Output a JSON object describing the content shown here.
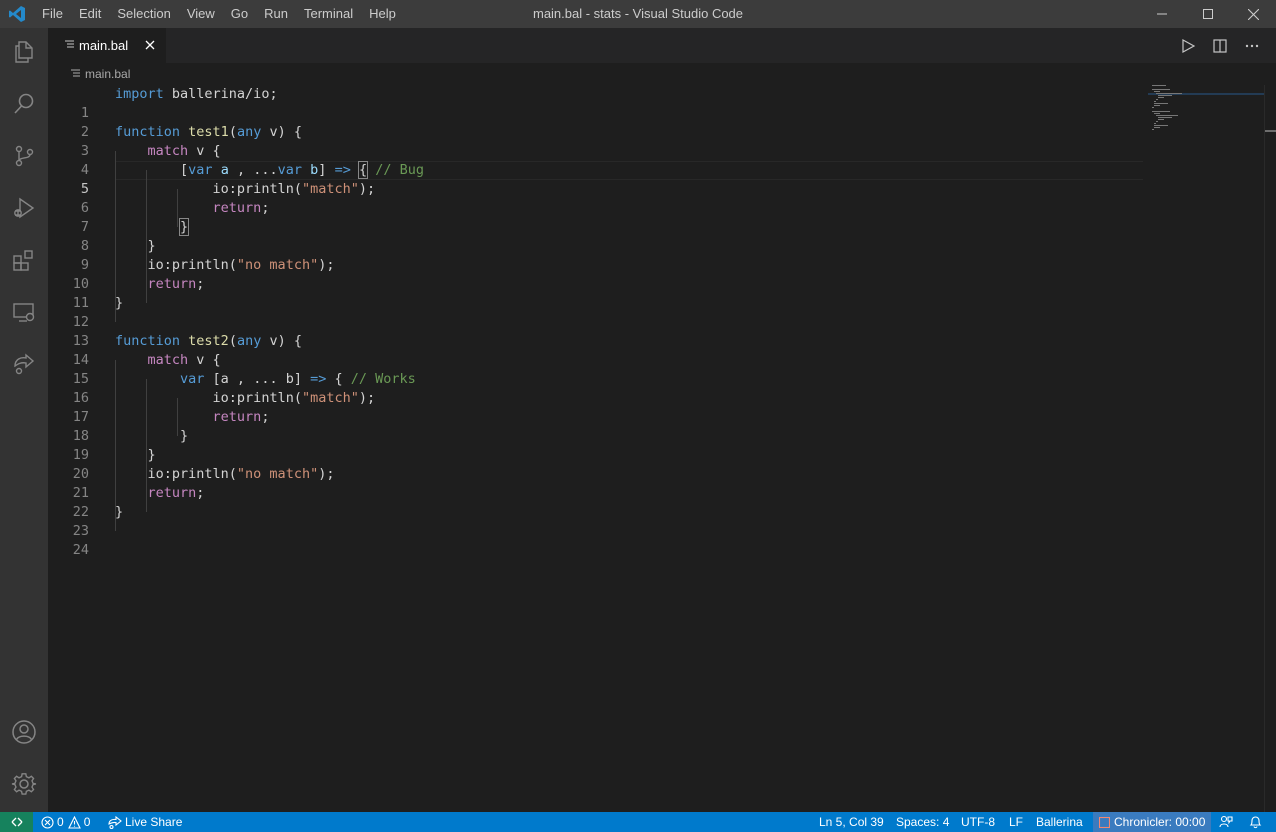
{
  "window": {
    "menu": [
      "File",
      "Edit",
      "Selection",
      "View",
      "Go",
      "Run",
      "Terminal",
      "Help"
    ],
    "title": "main.bal - stats - Visual Studio Code"
  },
  "activity_bar": {
    "items": [
      "explorer-icon",
      "search-icon",
      "source-control-icon",
      "run-debug-icon",
      "extensions-icon",
      "remote-explorer-icon",
      "live-share-icon"
    ],
    "bottom": [
      "account-icon",
      "settings-gear-icon"
    ]
  },
  "tab": {
    "label": "main.bal",
    "icon": "file-lines-icon"
  },
  "breadcrumb": {
    "label": "main.bal"
  },
  "editor": {
    "active_line": 5,
    "lines": [
      {
        "n": "1"
      },
      {
        "n": "2"
      },
      {
        "n": "3"
      },
      {
        "n": "4"
      },
      {
        "n": "5"
      },
      {
        "n": "6"
      },
      {
        "n": "7"
      },
      {
        "n": "8"
      },
      {
        "n": "9"
      },
      {
        "n": "10"
      },
      {
        "n": "11"
      },
      {
        "n": "12"
      },
      {
        "n": "13"
      },
      {
        "n": "14"
      },
      {
        "n": "15"
      },
      {
        "n": "16"
      },
      {
        "n": "17"
      },
      {
        "n": "18"
      },
      {
        "n": "19"
      },
      {
        "n": "20"
      },
      {
        "n": "21"
      },
      {
        "n": "22"
      },
      {
        "n": "23"
      },
      {
        "n": "24"
      }
    ],
    "tokens": {
      "l1": [
        "import",
        " ballerina/io;"
      ],
      "l3": [
        "function",
        " ",
        "test1",
        "(",
        "any",
        " v) {"
      ],
      "l4": [
        "match",
        " v {"
      ],
      "l5": [
        "[",
        "var",
        " ",
        "a",
        " , ...",
        "var",
        " ",
        "b",
        "] ",
        "=>",
        " ",
        "{",
        " ",
        "// Bug"
      ],
      "l6": [
        "io:println(",
        "\"match\"",
        ");"
      ],
      "l7": [
        "return",
        ";"
      ],
      "l8": [
        "}"
      ],
      "l9": [
        "}"
      ],
      "l10": [
        "io:println(",
        "\"no match\"",
        ");"
      ],
      "l11": [
        "return",
        ";"
      ],
      "l12": [
        "}"
      ],
      "l14": [
        "function",
        " ",
        "test2",
        "(",
        "any",
        " v) {"
      ],
      "l15": [
        "match",
        " v {"
      ],
      "l16": [
        "var",
        " [a , ... b] ",
        "=>",
        " { ",
        "// Works"
      ],
      "l17": [
        "io:println(",
        "\"match\"",
        ");"
      ],
      "l18": [
        "return",
        ";"
      ],
      "l19": [
        "}"
      ],
      "l20": [
        "}"
      ],
      "l21": [
        "io:println(",
        "\"no match\"",
        ");"
      ],
      "l22": [
        "return",
        ";"
      ],
      "l23": [
        "}"
      ]
    }
  },
  "status_bar": {
    "errors": "0",
    "warnings": "0",
    "live_share": "Live Share",
    "position": "Ln 5, Col 39",
    "spaces": "Spaces: 4",
    "encoding": "UTF-8",
    "eol": "LF",
    "language": "Ballerina",
    "chronicler": "Chronicler: 00:00"
  },
  "colors": {
    "accent": "#007acc",
    "remote": "#16825d",
    "keyword": "#569cd6",
    "control": "#c586c0",
    "string": "#ce9178",
    "comment": "#6a9955",
    "function": "#dcdcaa"
  }
}
